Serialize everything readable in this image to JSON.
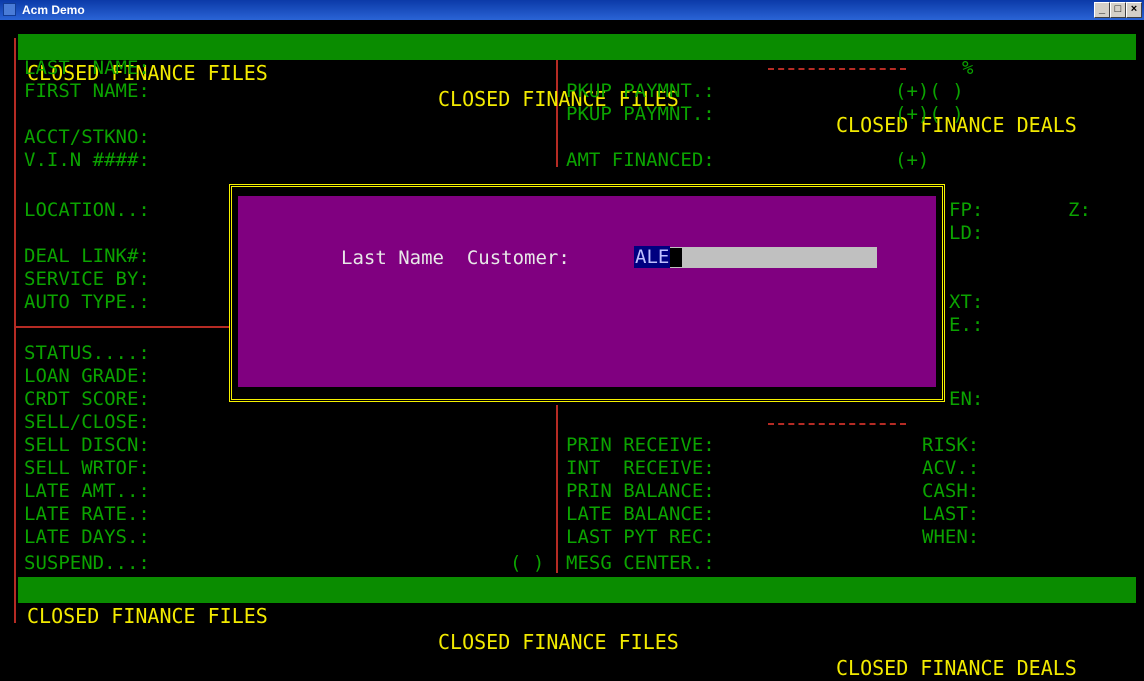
{
  "window": {
    "title": "Acm Demo",
    "minimize": "_",
    "maximize": "□",
    "close": "×"
  },
  "banners": {
    "top_left": "CLOSED FINANCE FILES",
    "top_mid": "CLOSED FINANCE FILES",
    "top_right": "CLOSED FINANCE DEALS",
    "bottom_left": "CLOSED FINANCE FILES",
    "bottom_mid": "CLOSED FINANCE FILES",
    "bottom_right": "CLOSED FINANCE DEALS"
  },
  "left_fields": [
    "LAST  NAME:",
    "FIRST NAME:",
    "ACCT/STKNO:",
    "V.I.N ####:",
    "LOCATION..:",
    "DEAL LINK#:",
    "SERVICE BY:",
    "AUTO TYPE.:",
    "STATUS....:",
    "LOAN GRADE:",
    "CRDT SCORE:",
    "SELL/CLOSE:",
    "SELL DISCN:",
    "SELL WRTOF:",
    "LATE AMT..:",
    "LATE RATE.:",
    "LATE DAYS.:",
    "SUSPEND...:"
  ],
  "mid_fields": [
    "PKUP PAYMNT.:",
    "PKUP PAYMNT.:",
    "AMT FINANCED:",
    "PRIN RECEIVE:",
    "INT  RECEIVE:",
    "PRIN BALANCE:",
    "LATE BALANCE:",
    "LAST PYT REC:",
    "MESG CENTER.:"
  ],
  "right_fields": [
    "%",
    "(+)( )",
    "(+)( )",
    "(+)",
    "FP:",
    "Z:",
    "LD:",
    "XT:",
    "E.:",
    "EN:",
    "RISK:",
    "ACV.:",
    "CASH:",
    "LAST:",
    "WHEN:"
  ],
  "suspend_flag": "( )",
  "dialog": {
    "label": "Last Name  Customer:",
    "value": "ALE"
  }
}
